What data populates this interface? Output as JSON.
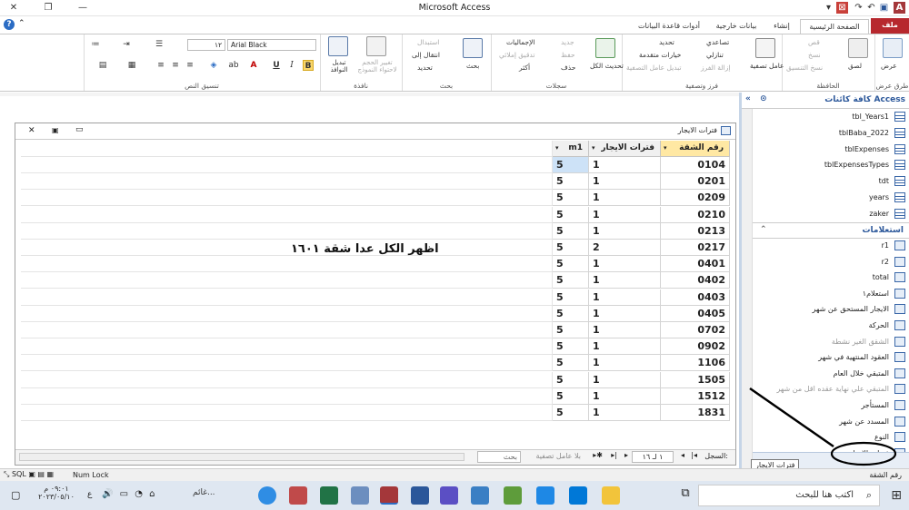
{
  "window": {
    "title": "Microsoft Access"
  },
  "tabs": [
    {
      "id": "file",
      "label": "ملف"
    },
    {
      "id": "home",
      "label": "الصفحة الرئيسية"
    },
    {
      "id": "create",
      "label": "إنشاء"
    },
    {
      "id": "external",
      "label": "بيانات خارجية"
    },
    {
      "id": "dbtools",
      "label": "أدوات قاعدة البيانات"
    }
  ],
  "ribbon": {
    "views": {
      "view": "عرض",
      "group": "طرق عرض"
    },
    "clipboard": {
      "paste": "لصق",
      "cut": "قص",
      "copy": "نسخ",
      "format_painter": "نسخ التنسيق",
      "group": "الحافظة"
    },
    "sort_filter": {
      "filter": "عامل تصفية",
      "ascending": "تصاعدي",
      "descending": "تنازلي",
      "remove_sort": "إزالة الفرز",
      "selection": "تحديد",
      "advanced": "خيارات متقدمة",
      "toggle_filter": "تبديل عامل التصفية",
      "group": "فرز وتصفية"
    },
    "records": {
      "refresh_all": "تحديث الكل",
      "new": "جديد",
      "save": "حفظ",
      "delete": "حذف",
      "totals": "الإجماليات",
      "spelling": "تدقيق إملائي",
      "more": "أكثر",
      "group": "سجلات"
    },
    "find": {
      "find": "بحث",
      "replace": "استبدال",
      "goto": "انتقال إلى",
      "select": "تحديد",
      "group": "بحث"
    },
    "window": {
      "size_to_fit": "تغيير الحجم لاحتواء النموذج",
      "switch_windows": "تبديل النوافذ",
      "group": "نافذة"
    },
    "text_formatting": {
      "font_name": "Arial Black",
      "font_size": "١٢",
      "bold": "B",
      "italic": "I",
      "underline": "U",
      "font_color_letter": "A",
      "group": "تنسيق النص"
    }
  },
  "datasheet": {
    "title": "فترات الايجار",
    "columns": [
      "رقم الشقة",
      "فترات الايجار",
      "m1"
    ],
    "rows": [
      [
        "0104",
        "1",
        "5"
      ],
      [
        "0201",
        "1",
        "5"
      ],
      [
        "0209",
        "1",
        "5"
      ],
      [
        "0210",
        "1",
        "5"
      ],
      [
        "0213",
        "1",
        "5"
      ],
      [
        "0217",
        "2",
        "5"
      ],
      [
        "0401",
        "1",
        "5"
      ],
      [
        "0402",
        "1",
        "5"
      ],
      [
        "0403",
        "1",
        "5"
      ],
      [
        "0405",
        "1",
        "5"
      ],
      [
        "0702",
        "1",
        "5"
      ],
      [
        "0902",
        "1",
        "5"
      ],
      [
        "1106",
        "1",
        "5"
      ],
      [
        "1505",
        "1",
        "5"
      ],
      [
        "1512",
        "1",
        "5"
      ],
      [
        "1831",
        "1",
        "5"
      ]
    ],
    "annotation": "اظهر الكل عدا شقة ١٦٠١",
    "record_nav": {
      "label": "السجل:",
      "position": "١ لـ ١٦",
      "filter": "بلا عامل تصفية",
      "search": "بحث"
    }
  },
  "nav_pane": {
    "title": "كافة كائنات Access",
    "tables": [
      "tbl_Years1",
      "tblBaba_2022",
      "tblExpenses",
      "tblExpensesTypes",
      "tdt",
      "years",
      "zaker"
    ],
    "queries_header": "استعلامات",
    "queries": [
      {
        "name": "r1",
        "dim": false
      },
      {
        "name": "r2",
        "dim": false
      },
      {
        "name": "total",
        "dim": false
      },
      {
        "name": "استعلام١",
        "dim": false
      },
      {
        "name": "الايجار المستحق عن شهر",
        "dim": false
      },
      {
        "name": "الحركة",
        "dim": false
      },
      {
        "name": "الشقق الغير نشطة",
        "dim": true
      },
      {
        "name": "العقود المنتهية في شهر",
        "dim": false
      },
      {
        "name": "المتبقي خلال العام",
        "dim": false
      },
      {
        "name": "المتبقي علي نهاية عقده اقل من شهر",
        "dim": true
      },
      {
        "name": "المستأجر",
        "dim": false
      },
      {
        "name": "المسدد عن شهر",
        "dim": false
      },
      {
        "name": "النوع",
        "dim": false
      },
      {
        "name": "فترات الايجار",
        "dim": false
      }
    ],
    "tooltip": "فترات الايجار"
  },
  "status": {
    "left": "رقم الشقة",
    "numlock": "Num Lock"
  },
  "taskbar": {
    "search": "اكتب هنا للبحث",
    "time": "٠٩:٠١ م",
    "date": "٢٠٢٣/٠٥/١٠",
    "lang": "ع",
    "app_label": "غائم..."
  },
  "colors": {
    "file_tab": "#b7282e",
    "selected_header": "#ffe8a3",
    "current_row": "#cde2f7",
    "access_red": "#a4373a"
  }
}
